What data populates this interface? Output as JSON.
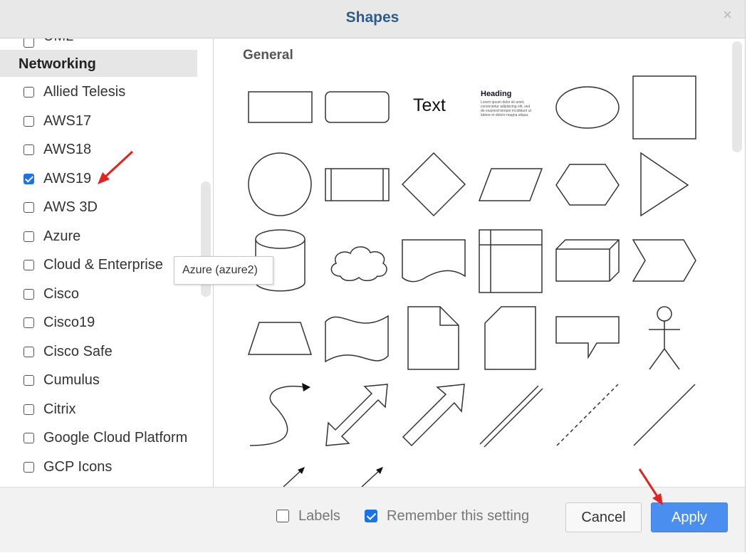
{
  "dialog": {
    "title": "Shapes",
    "close_symbol": "×"
  },
  "sidebar": {
    "partial_item": "UML",
    "category": "Networking",
    "items": [
      {
        "label": "Allied Telesis",
        "checked": false
      },
      {
        "label": "AWS17",
        "checked": false
      },
      {
        "label": "AWS18",
        "checked": false
      },
      {
        "label": "AWS19",
        "checked": true
      },
      {
        "label": "AWS 3D",
        "checked": false
      },
      {
        "label": "Azure",
        "checked": false
      },
      {
        "label": "Cloud & Enterprise",
        "checked": false
      },
      {
        "label": "Cisco",
        "checked": false
      },
      {
        "label": "Cisco19",
        "checked": false
      },
      {
        "label": "Cisco Safe",
        "checked": false
      },
      {
        "label": "Cumulus",
        "checked": false
      },
      {
        "label": "Citrix",
        "checked": false
      },
      {
        "label": "Google Cloud Platform",
        "checked": false
      },
      {
        "label": "GCP Icons",
        "checked": false
      }
    ]
  },
  "tooltip": {
    "text": "Azure (azure2)"
  },
  "content": {
    "section_title": "General",
    "shapes": [
      {
        "name": "rectangle-shape",
        "text": ""
      },
      {
        "name": "rounded-rectangle-shape",
        "text": ""
      },
      {
        "name": "text-shape",
        "text": "Text"
      },
      {
        "name": "textbox-shape",
        "text": "Heading",
        "lines": [
          "Lorem ipsum dolor sit amet,",
          "consectetur adipisicing elit, sed",
          "do eiusmod tempor incididunt ut",
          "labore et dolore magna aliqua."
        ]
      },
      {
        "name": "ellipse-shape",
        "text": ""
      },
      {
        "name": "square-shape",
        "text": ""
      },
      {
        "name": "circle-shape",
        "text": ""
      },
      {
        "name": "process-shape",
        "text": ""
      },
      {
        "name": "diamond-shape",
        "text": ""
      },
      {
        "name": "parallelogram-shape",
        "text": ""
      },
      {
        "name": "hexagon-shape",
        "text": ""
      },
      {
        "name": "triangle-shape",
        "text": ""
      },
      {
        "name": "cylinder-shape",
        "text": ""
      },
      {
        "name": "cloud-shape",
        "text": ""
      },
      {
        "name": "document-shape",
        "text": ""
      },
      {
        "name": "internal-storage-shape",
        "text": ""
      },
      {
        "name": "cube-shape",
        "text": ""
      },
      {
        "name": "step-shape",
        "text": ""
      },
      {
        "name": "trapezoid-shape",
        "text": ""
      },
      {
        "name": "tape-shape",
        "text": ""
      },
      {
        "name": "note-shape",
        "text": ""
      },
      {
        "name": "card-shape",
        "text": ""
      },
      {
        "name": "callout-shape",
        "text": ""
      },
      {
        "name": "actor-shape",
        "text": ""
      },
      {
        "name": "curved-arrow-shape",
        "text": ""
      },
      {
        "name": "bidirectional-arrow-shape",
        "text": ""
      },
      {
        "name": "arrow-shape",
        "text": ""
      },
      {
        "name": "double-line-shape",
        "text": ""
      },
      {
        "name": "dashed-line-shape",
        "text": ""
      },
      {
        "name": "line-shape",
        "text": ""
      },
      {
        "name": "connector-arrow-shape",
        "text": ""
      },
      {
        "name": "connector-arrow-shape-2",
        "text": ""
      }
    ]
  },
  "footer": {
    "labels_option": {
      "label": "Labels",
      "checked": false
    },
    "remember_option": {
      "label": "Remember this setting",
      "checked": true
    },
    "cancel_label": "Cancel",
    "apply_label": "Apply"
  },
  "colors": {
    "title": "#2e5c8a",
    "checkbox_checked": "#1a73e8",
    "apply_button": "#4a8ff0",
    "annotation_arrow": "#e8211e"
  }
}
